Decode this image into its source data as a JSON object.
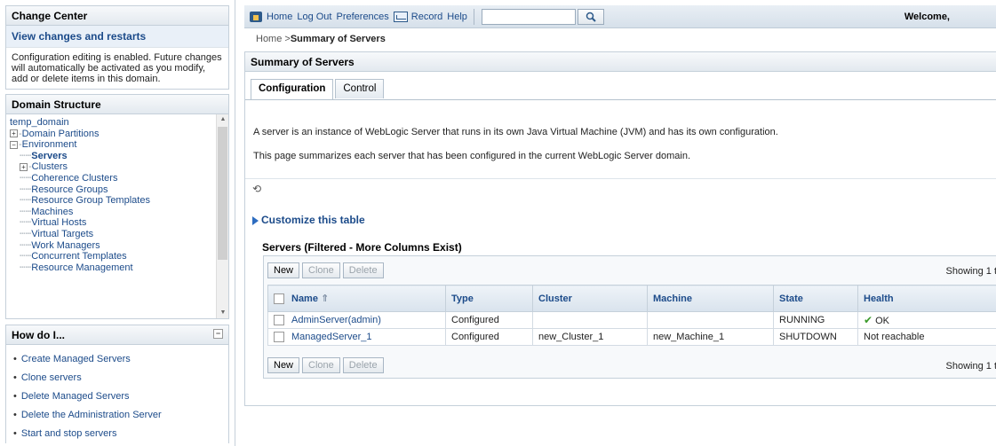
{
  "change_center": {
    "title": "Change Center",
    "link": "View changes and restarts",
    "text": "Configuration editing is enabled. Future changes will automatically be activated as you modify, add or delete items in this domain."
  },
  "domain_structure": {
    "title": "Domain Structure",
    "root": "temp_domain",
    "items": [
      {
        "label": "Domain Partitions",
        "expander": "+"
      },
      {
        "label": "Environment",
        "expander": "-"
      },
      {
        "label": "Servers"
      },
      {
        "label": "Clusters",
        "expander": "+"
      },
      {
        "label": "Coherence Clusters"
      },
      {
        "label": "Resource Groups"
      },
      {
        "label": "Resource Group Templates"
      },
      {
        "label": "Machines"
      },
      {
        "label": "Virtual Hosts"
      },
      {
        "label": "Virtual Targets"
      },
      {
        "label": "Work Managers"
      },
      {
        "label": "Concurrent Templates"
      },
      {
        "label": "Resource Management"
      }
    ]
  },
  "how_do_i": {
    "title": "How do I...",
    "items": [
      "Create Managed Servers",
      "Clone servers",
      "Delete Managed Servers",
      "Delete the Administration Server",
      "Start and stop servers"
    ]
  },
  "topbar": {
    "home": "Home",
    "logout": "Log Out",
    "preferences": "Preferences",
    "record": "Record",
    "help": "Help",
    "search_value": "",
    "welcome": "Welcome,"
  },
  "breadcrumb": {
    "prefix": "Home >",
    "current": "Summary of Servers"
  },
  "main": {
    "title": "Summary of Servers",
    "tabs": [
      "Configuration",
      "Control"
    ],
    "desc1": "A server is an instance of WebLogic Server that runs in its own Java Virtual Machine (JVM) and has its own configuration.",
    "desc2": "This page summarizes each server that has been configured in the current WebLogic Server domain.",
    "customize": "Customize this table",
    "table_title": "Servers (Filtered - More Columns Exist)",
    "buttons": {
      "new": "New",
      "clone": "Clone",
      "delete": "Delete"
    },
    "showing": "Showing 1 t",
    "columns": [
      "Name",
      "Type",
      "Cluster",
      "Machine",
      "State",
      "Health"
    ],
    "rows": [
      {
        "name": "AdminServer(admin)",
        "type": "Configured",
        "cluster": "",
        "machine": "",
        "state": "RUNNING",
        "health": "OK"
      },
      {
        "name": "ManagedServer_1",
        "type": "Configured",
        "cluster": "new_Cluster_1",
        "machine": "new_Machine_1",
        "state": "SHUTDOWN",
        "health": "Not reachable"
      }
    ]
  }
}
